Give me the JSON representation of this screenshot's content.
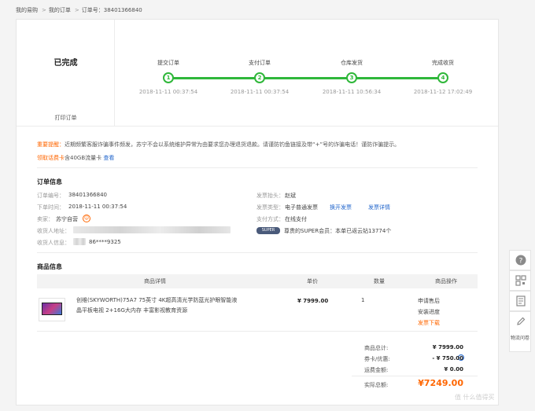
{
  "breadcrumb": {
    "home": "我的易购",
    "orders": "我的订单",
    "current": "订单号：38401366840"
  },
  "status": {
    "state": "已完成",
    "print": "打印订单"
  },
  "progress": {
    "steps": [
      {
        "label": "提交订单",
        "num": "1",
        "time": "2018-11-11 00:37:54"
      },
      {
        "label": "支付订单",
        "num": "2",
        "time": "2018-11-11 00:37:54"
      },
      {
        "label": "仓库发货",
        "num": "3",
        "time": "2018-11-11 10:56:34"
      },
      {
        "label": "完成收货",
        "num": "4",
        "time": "2018-11-12 17:02:49"
      }
    ],
    "color": "#2fb73a"
  },
  "notice": {
    "key": "重要提醒：",
    "text": "近期频繁客服诈骗事件频发，苏宁不会以系统维护异常为由要求您办理退货退款。请谨防钓鱼链接及带“+”号的诈骗电话！谨防诈骗提示。"
  },
  "promo": {
    "key": "领取话费卡",
    "text": "含40GB流量卡",
    "link": "查看"
  },
  "order_info": {
    "title": "订单信息",
    "order_no_label": "订单编号：",
    "order_no": "38401366840",
    "order_time_label": "下单时间：",
    "order_time": "2018-11-11 00:37:54",
    "seller_label": "卖家：",
    "seller": "苏宁自营",
    "addr_label": "收货人地址：",
    "recv_label": "收货人信息：",
    "recv_phone": "86****9325",
    "invoice_title_label": "发票抬头：",
    "invoice_title": "赵斌",
    "invoice_type_label": "发票类型：",
    "invoice_type": "电子普通发票",
    "switch_invoice": "换开发票",
    "invoice_detail": "发票详情",
    "pay_label": "支付方式：",
    "pay": "在线支付",
    "super_badge": "SUPER",
    "super_text": "尊贵的SUPER会员：本单已返云钻13774个"
  },
  "products": {
    "title": "商品信息",
    "headers": [
      "商品详情",
      "单价",
      "数量",
      "商品操作"
    ],
    "items": [
      {
        "name": "创维(SKYWORTH)75A7 75英寸 4K超高清光学防蓝光护眼智能液晶平板电视 2+16G大内存 丰富影视教育资源",
        "price": "¥ 7999.00",
        "qty": "1",
        "ops": [
          "申请售后",
          "安装进度",
          "发票下载"
        ]
      }
    ]
  },
  "summary": {
    "total_label": "商品总计:",
    "total": "¥ 7999.00",
    "coupon_label": "券卡/优惠:",
    "coupon": "- ¥ 750.00",
    "shipping_label": "运费金额:",
    "shipping": "¥ 0.00",
    "paid_label": "实际总额:",
    "paid": "¥7249.00"
  },
  "sidebar": {
    "help_icon": "question-icon",
    "qr_icon": "qr-icon",
    "note_icon": "note-icon",
    "edit_icon": "edit-icon",
    "survey": "物流问卷"
  },
  "watermark": "值 什么值得买"
}
